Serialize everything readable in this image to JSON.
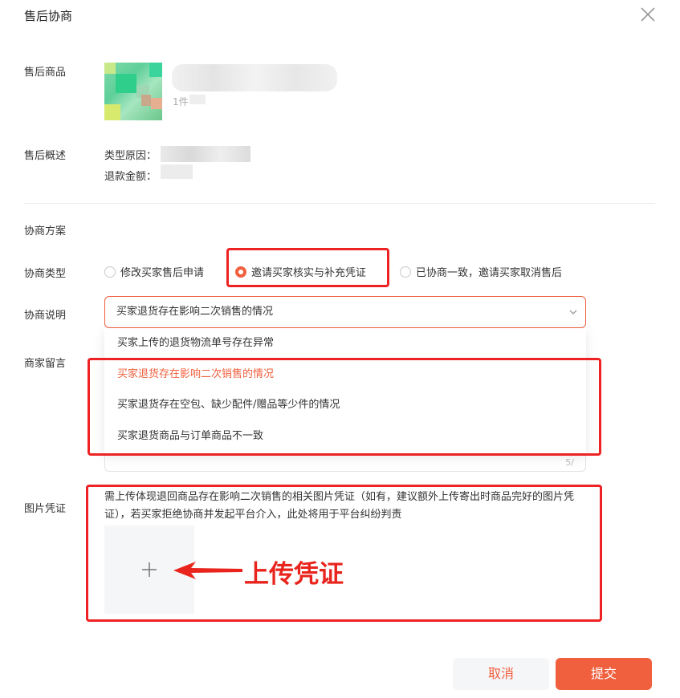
{
  "dialog": {
    "title": "售后协商"
  },
  "product": {
    "label": "售后商品",
    "qty_prefix": "1件"
  },
  "summary": {
    "label": "售后概述",
    "type_reason_label": "类型原因：",
    "refund_amount_label": "退款金额："
  },
  "plan": {
    "section_label": "协商方案",
    "type_label": "协商类型",
    "types": [
      {
        "label": "修改买家售后申请",
        "selected": false
      },
      {
        "label": "邀请买家核实与补充凭证",
        "selected": true
      },
      {
        "label": "已协商一致，邀请买家取消售后",
        "selected": false
      }
    ],
    "desc_label": "协商说明",
    "desc_value": "买家退货存在影响二次销售的情况",
    "options": [
      "买家上传的退货物流单号存在异常",
      "买家退货存在影响二次销售的情况",
      "买家退货存在空包、缺少配件/赠品等少件的情况",
      "买家退货商品与订单商品不一致"
    ],
    "selected_option_index": 1
  },
  "message": {
    "label": "商家留言",
    "counter": "5/"
  },
  "evidence": {
    "label": "图片凭证",
    "hint": "需上传体现退回商品存在影响二次销售的相关图片凭证（如有，建议额外上传寄出时商品完好的图片凭证），若买家拒绝协商并发起平台介入，此处将用于平台纠纷判责",
    "upload_glyph": "+"
  },
  "annotation": {
    "text": "上传凭证"
  },
  "footer": {
    "cancel_label": "取消",
    "submit_label": "提交"
  },
  "colors": {
    "accent": "#f0603f",
    "annotation_red": "#ee2222"
  }
}
